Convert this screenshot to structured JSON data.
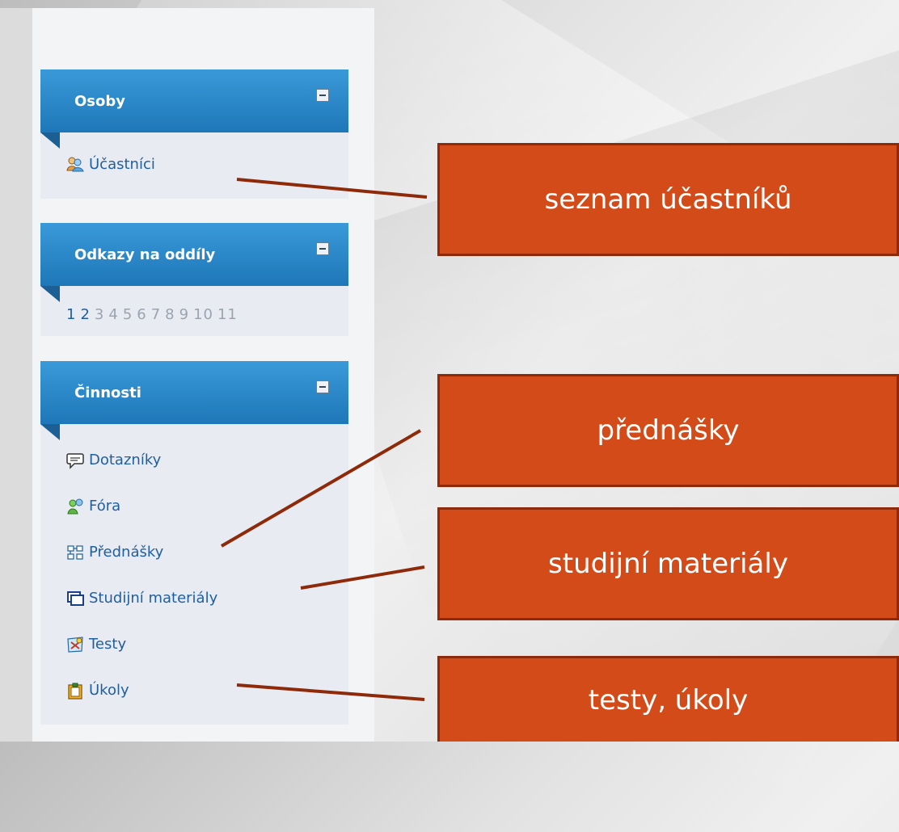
{
  "blocks": [
    {
      "title": "Osoby",
      "items": [
        {
          "label": "Účastníci",
          "icon": "participants-icon"
        }
      ]
    },
    {
      "title": "Odkazy na oddíly",
      "pages": [
        "1",
        "2",
        "3",
        "4",
        "5",
        "6",
        "7",
        "8",
        "9",
        "10",
        "11"
      ],
      "active_pages": [
        "1",
        "2"
      ]
    },
    {
      "title": "Činnosti",
      "items": [
        {
          "label": "Dotazníky",
          "icon": "survey-icon"
        },
        {
          "label": "Fóra",
          "icon": "forum-icon"
        },
        {
          "label": "Přednášky",
          "icon": "lesson-icon"
        },
        {
          "label": "Studijní materiály",
          "icon": "resource-icon"
        },
        {
          "label": "Testy",
          "icon": "quiz-icon"
        },
        {
          "label": "Úkoly",
          "icon": "assignment-icon"
        }
      ]
    }
  ],
  "callouts": [
    {
      "text": "seznam účastníků"
    },
    {
      "text": "přednášky"
    },
    {
      "text": "studijní materiály"
    },
    {
      "text": "testy, úkoly"
    }
  ],
  "colors": {
    "accent": "#1e77b8",
    "callout": "#d24b19",
    "connector": "#8e2a0a"
  }
}
